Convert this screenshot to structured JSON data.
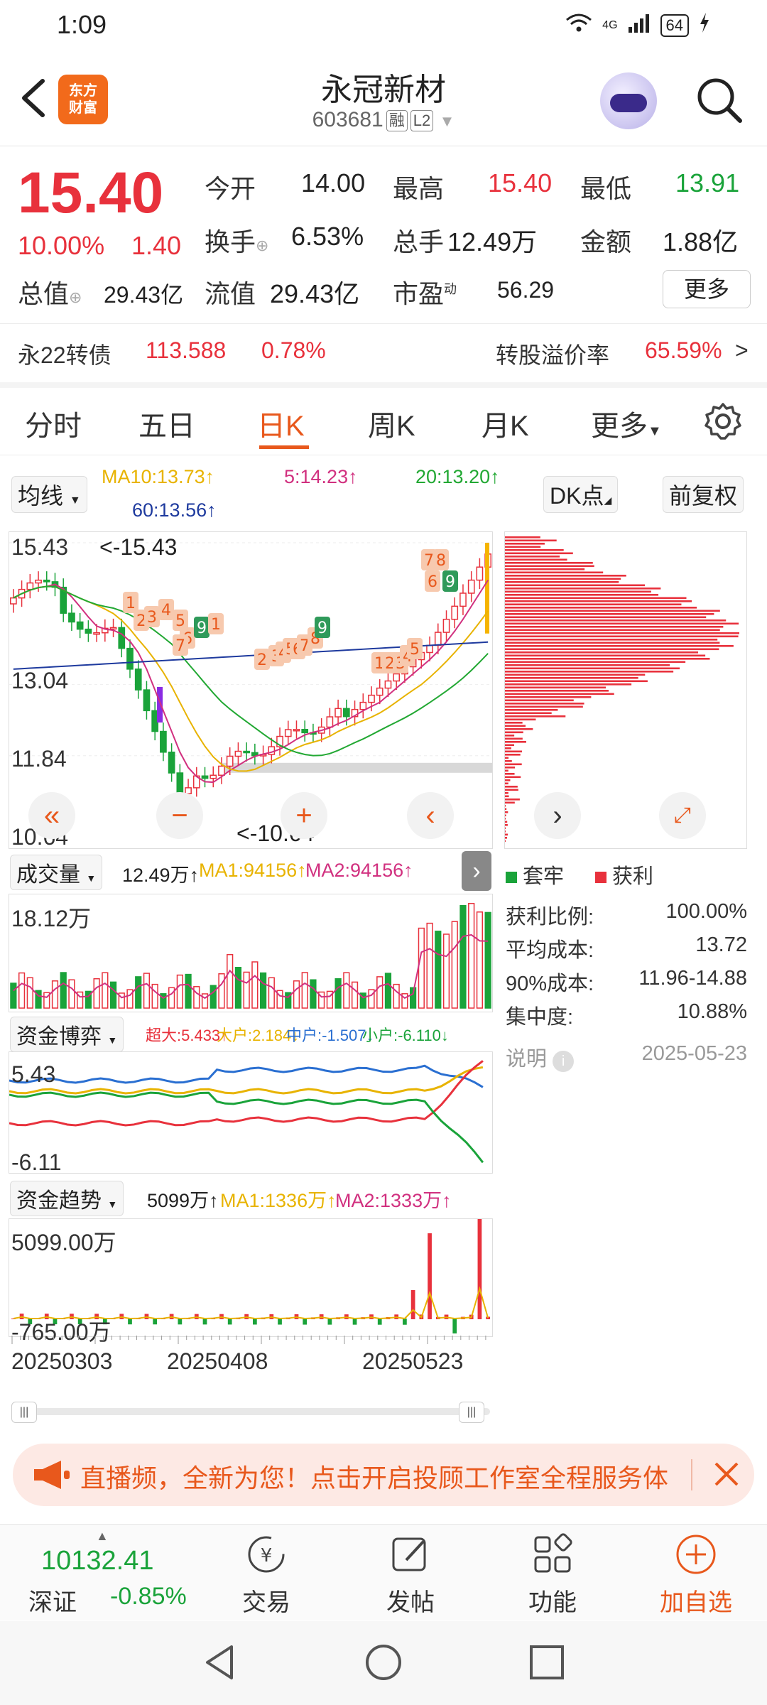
{
  "status_bar": {
    "time": "1:09",
    "network": "4G",
    "battery": "64"
  },
  "header": {
    "app_logo_line1": "东方",
    "app_logo_line2": "财富",
    "stock_name": "永冠新材",
    "stock_code": "603681",
    "tag_margin": "融",
    "tag_level": "L2"
  },
  "quote": {
    "price": "15.40",
    "change_pct": "10.00%",
    "change_abs": "1.40",
    "open_label": "今开",
    "open": "14.00",
    "high_label": "最高",
    "high": "15.40",
    "low_label": "最低",
    "low": "13.91",
    "turnover_label": "换手",
    "turnover": "6.53%",
    "volume_label": "总手",
    "volume": "12.49万",
    "amount_label": "金额",
    "amount": "1.88亿",
    "mktcap_label": "总值",
    "mktcap": "29.43亿",
    "float_label": "流值",
    "float": "29.43亿",
    "pe_label": "市盈",
    "pe_sup": "动",
    "pe": "56.29",
    "more_label": "更多"
  },
  "bond": {
    "name": "永22转债",
    "price": "113.588",
    "pct": "0.78%",
    "premium_label": "转股溢价率",
    "premium": "65.59%"
  },
  "tabs": [
    "分时",
    "五日",
    "日K",
    "周K",
    "月K",
    "更多"
  ],
  "active_tab": "日K",
  "kline": {
    "indicator_select": "均线",
    "ma10": "MA10:13.73↑",
    "ma5": "5:14.23↑",
    "ma20": "20:13.20↑",
    "ma60": "60:13.56↑",
    "dk_label": "DK点",
    "adjust_label": "前复权",
    "y_high": "15.43",
    "y_mid1": "13.04",
    "y_mid2": "11.84",
    "y_low": "10.64",
    "max_marker": "<-15.43",
    "min_marker": "<-10.64",
    "dk_markers": [
      "7",
      "8",
      "6",
      "9",
      "1",
      "2",
      "3",
      "4",
      "5",
      "6",
      "7",
      "9",
      "1",
      "2",
      "3",
      "4",
      "5",
      "6",
      "7",
      "8",
      "9",
      "1",
      "2",
      "3",
      "4",
      "5"
    ],
    "colors": {
      "up": "#e8313c",
      "down": "#1aa33a",
      "ma5": "#d1307f",
      "ma10": "#e8b300",
      "ma20": "#22a833",
      "ma60": "#1e3a9e"
    }
  },
  "volume": {
    "select": "成交量",
    "value": "12.49万↑",
    "ma1": "MA1:94156↑",
    "ma2": "MA2:94156↑",
    "y_top": "18.12万"
  },
  "capital_game": {
    "select": "资金博弈",
    "super": "超大:5.433↑",
    "big": "大户:2.184↓",
    "mid": "中户:-1.507↓",
    "small": "小户:-6.110↓",
    "y_top": "5.43",
    "y_bottom": "-6.11"
  },
  "capital_trend": {
    "select": "资金趋势",
    "value": "5099万↑",
    "ma1": "MA1:1336万↑",
    "ma2": "MA2:1333万↑",
    "y_top": "5099.00万",
    "y_bottom": "-765.00万"
  },
  "x_dates": [
    "20250303",
    "20250408",
    "20250523"
  ],
  "chip": {
    "legend_trapped": "套牢",
    "legend_profit": "获利",
    "profit_ratio_label": "获利比例:",
    "profit_ratio": "100.00%",
    "avg_cost_label": "平均成本:",
    "avg_cost": "13.72",
    "cost90_label": "90%成本:",
    "cost90": "11.96-14.88",
    "concentration_label": "集中度:",
    "concentration": "10.88%",
    "note_label": "说明",
    "date": "2025-05-23"
  },
  "banner": {
    "text": "直播频，全新为您！点击开启投顾工作室全程服务体"
  },
  "bottom_nav": {
    "index_value": "10132.41",
    "index_name": "深证",
    "index_pct": "-0.85%",
    "trade": "交易",
    "post": "发帖",
    "function": "功能",
    "add_watch": "加自选"
  }
}
